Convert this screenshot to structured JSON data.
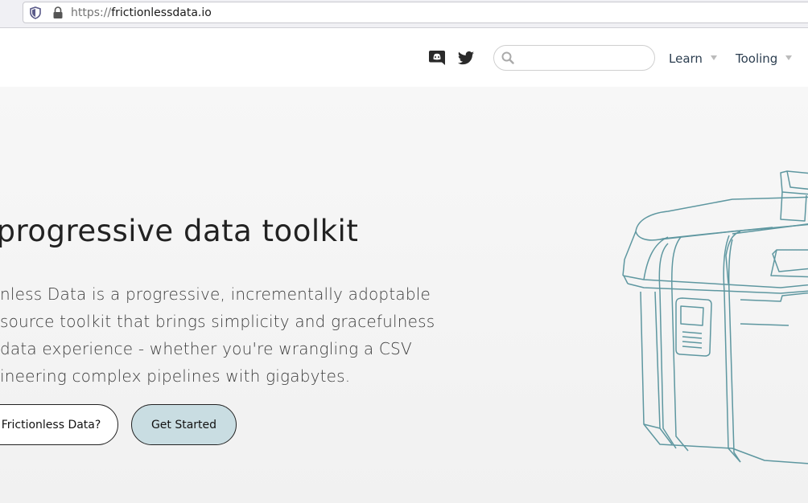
{
  "browser": {
    "url_protocol": "https://",
    "url_host": "frictionlessdata.io"
  },
  "header": {
    "search": {
      "placeholder": "",
      "value": ""
    },
    "nav": [
      {
        "label": "Learn"
      },
      {
        "label": "Tooling"
      }
    ],
    "icons": [
      "discord-icon",
      "twitter-icon",
      "search-icon"
    ]
  },
  "hero": {
    "title": "e progressive data toolkit",
    "description_lines": [
      "nless Data is a progressive, incrementally adoptable",
      "source toolkit that brings simplicity and gracefulness",
      " data experience - whether you're wrangling a CSV",
      "ineering complex pipelines with gigabytes."
    ],
    "buttons": {
      "why": "Frictionless Data?",
      "start": "Get Started"
    }
  },
  "colors": {
    "hero_bg": "#f5f5f5",
    "button_primary_bg": "#c9dde2",
    "illustration_stroke": "#5e97a0",
    "nav_text": "#2c3e50"
  }
}
